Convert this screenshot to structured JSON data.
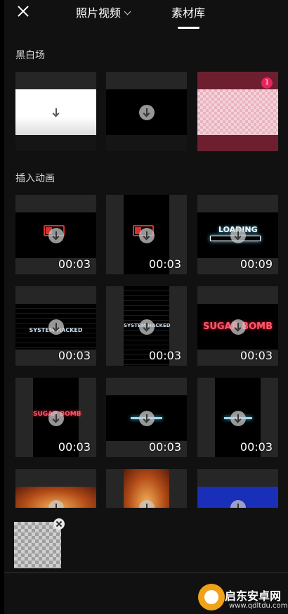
{
  "header": {
    "tab_photos": "照片视频",
    "tab_library": "素材库"
  },
  "sections": {
    "black_white": "黑白场",
    "insert_anim": "插入动画"
  },
  "black_white_tiles": [
    {
      "kind": "white"
    },
    {
      "kind": "black"
    },
    {
      "kind": "transparent",
      "badge": "1"
    }
  ],
  "animation_tiles": [
    {
      "duration": "00:03",
      "overlay": ""
    },
    {
      "duration": "00:03",
      "overlay": ""
    },
    {
      "duration": "00:09",
      "overlay": "LOADING"
    },
    {
      "duration": "00:03",
      "overlay": "SYSTEM HACKED"
    },
    {
      "duration": "00:03",
      "overlay": "SYSTEM HACKED"
    },
    {
      "duration": "00:03",
      "overlay": "SUGAR BOMB"
    },
    {
      "duration": "00:03",
      "overlay": "SUGAR BOMB"
    },
    {
      "duration": "00:03",
      "overlay": ""
    },
    {
      "duration": "00:03",
      "overlay": ""
    }
  ],
  "watermark": {
    "title": "启东安卓网",
    "url": "www.qdltdu.com"
  },
  "colors": {
    "accent_badge": "#e8245c",
    "background": "#111111"
  }
}
